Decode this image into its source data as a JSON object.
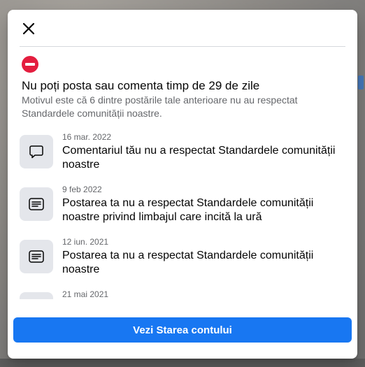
{
  "modal": {
    "close_icon": "close-icon",
    "alert_icon": "no-entry-icon",
    "title": "Nu poți posta sau comenta timp de 29 de zile",
    "subtitle": "Motivul este că 6 dintre postările tale anterioare nu au respectat Standardele comunității noastre.",
    "cta_label": "Vezi Starea contului"
  },
  "violations": [
    {
      "icon": "comment-bubble-icon",
      "date": "16 mar. 2022",
      "text": "Comentariul tău nu a respectat Standardele comunității noastre"
    },
    {
      "icon": "post-lines-icon",
      "date": "9 feb 2022",
      "text": "Postarea ta nu a respectat Standardele comunității noastre privind limbajul care incită la ură"
    },
    {
      "icon": "post-lines-icon",
      "date": "12 iun. 2021",
      "text": "Postarea ta nu a respectat Standardele comunității noastre"
    },
    {
      "icon": "post-lines-icon",
      "date": "21 mai 2021",
      "text": ""
    }
  ],
  "colors": {
    "accent": "#1877f2",
    "alert": "#e41e3f",
    "text_primary": "#050505",
    "text_secondary": "#65676b"
  }
}
